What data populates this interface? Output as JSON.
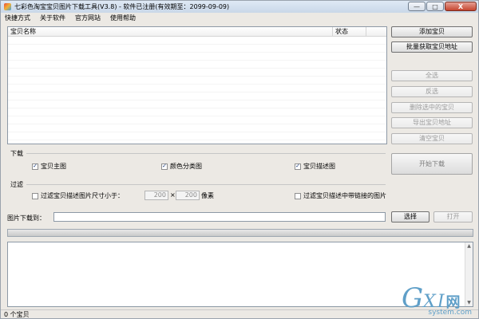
{
  "window": {
    "title": "七彩色淘宝宝贝图片下载工具(V3.8) - 软件已注册(有效期至：2099-09-09)",
    "min_glyph": "—",
    "max_glyph": "□",
    "close_glyph": "X"
  },
  "menu": {
    "items": [
      "快捷方式",
      "关于软件",
      "官方网站",
      "使用帮助"
    ]
  },
  "list": {
    "col_name": "宝贝名称",
    "col_state": "状态"
  },
  "buttons": {
    "add": "添加宝贝",
    "batch": "批量获取宝贝地址",
    "select_all": "全选",
    "invert": "反选",
    "delete_selected": "删除选中的宝贝",
    "export": "导出宝贝地址",
    "clear": "清空宝贝",
    "start": "开始下载",
    "choose": "选择",
    "open": "打开"
  },
  "download": {
    "label": "下载",
    "main_image": {
      "label": "宝贝主图",
      "checked": true
    },
    "color_image": {
      "label": "颜色分类图",
      "checked": true
    },
    "desc_image": {
      "label": "宝贝描述图",
      "checked": true
    }
  },
  "filter": {
    "label": "过滤",
    "size_filter": {
      "label": "过滤宝贝描述图片尺寸小于：",
      "checked": false
    },
    "width": "200",
    "times": "×",
    "height": "200",
    "unit": "像素",
    "link_filter": {
      "label": "过滤宝贝描述中带链接的图片",
      "checked": false
    }
  },
  "path": {
    "label": "图片下载到：",
    "value": ""
  },
  "log": {
    "up_arrow": "▲",
    "down_arrow": "▼"
  },
  "status": {
    "text": "0 个宝贝"
  },
  "watermark": {
    "g": "G",
    "xi": "XI",
    "cn": "网",
    "sub": "system.com"
  }
}
